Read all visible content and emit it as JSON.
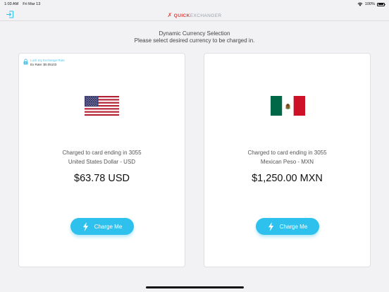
{
  "status_bar": {
    "time": "1:03 AM",
    "date": "Fri Mar 13",
    "battery": "100%"
  },
  "navbar": {
    "brand_quick": "QUICK",
    "brand_exchanger": "EXCHANGER",
    "brand_color": "#e23a3a"
  },
  "heading": {
    "title": "Dynamic Currency Selection",
    "subtitle": "Please select desired currency to be charged in."
  },
  "cards": [
    {
      "lock_label": "Lock my Exchange Rate",
      "rate_label": "Ex Rate: $0.05103",
      "flag": "usa-flag",
      "charge_line": "Charged to card ending in 3055",
      "currency_name": "United States Dollar - USD",
      "amount": "$63.78 USD",
      "button_label": "Charge Me"
    },
    {
      "flag": "mexico-flag",
      "charge_line": "Charged to card ending in 3055",
      "currency_name": "Mexican Peso - MXN",
      "amount": "$1,250.00 MXN",
      "button_label": "Charge Me"
    }
  ],
  "colors": {
    "accent": "#2ec1ee",
    "lock_accent": "#52c4ea"
  }
}
